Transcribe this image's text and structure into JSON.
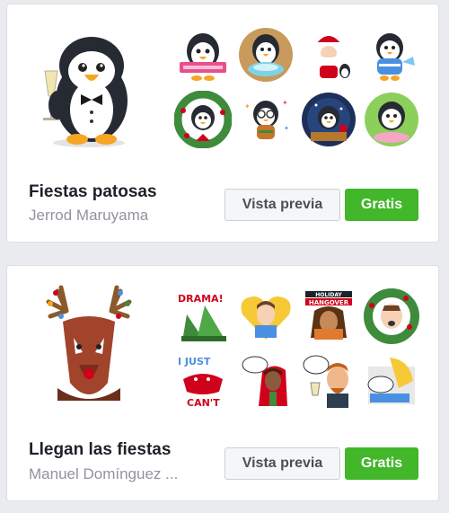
{
  "packs": [
    {
      "title": "Fiestas patosas",
      "author": "Jerrod Maruyama",
      "preview_label": "Vista previa",
      "free_label": "Gratis",
      "hero_icon": "penguin-tuxedo-champagne-icon",
      "stickers": [
        "penguin-holding-banner-icon",
        "penguin-on-ice-bowl-icon",
        "penguin-santa-icon",
        "penguin-blue-sweater-icon",
        "penguin-wreath-icon",
        "penguin-glasses-sparkles-icon",
        "penguin-night-window-icon",
        "penguin-green-circle-icon"
      ]
    },
    {
      "title": "Llegan las fiestas",
      "author": "Manuel Domínguez ...",
      "preview_label": "Vista previa",
      "free_label": "Gratis",
      "hero_icon": "reindeer-with-lights-icon",
      "stickers": [
        "drama-tree-icon",
        "man-on-yellow-heart-icon",
        "holiday-hangover-woman-icon",
        "man-in-wreath-icon",
        "i-just-cant-lobster-icon",
        "man-thanks-i-hate-it-icon",
        "man-lets-get-wasted-icon",
        "wake-me-after-holidays-icon"
      ],
      "sticker_texts": {
        "drama": "DRAMA!",
        "hangover_top": "HOLIDAY",
        "hangover_bottom": "HANGOVER",
        "i_just": "I JUST",
        "cant": "CAN'T"
      }
    }
  ]
}
